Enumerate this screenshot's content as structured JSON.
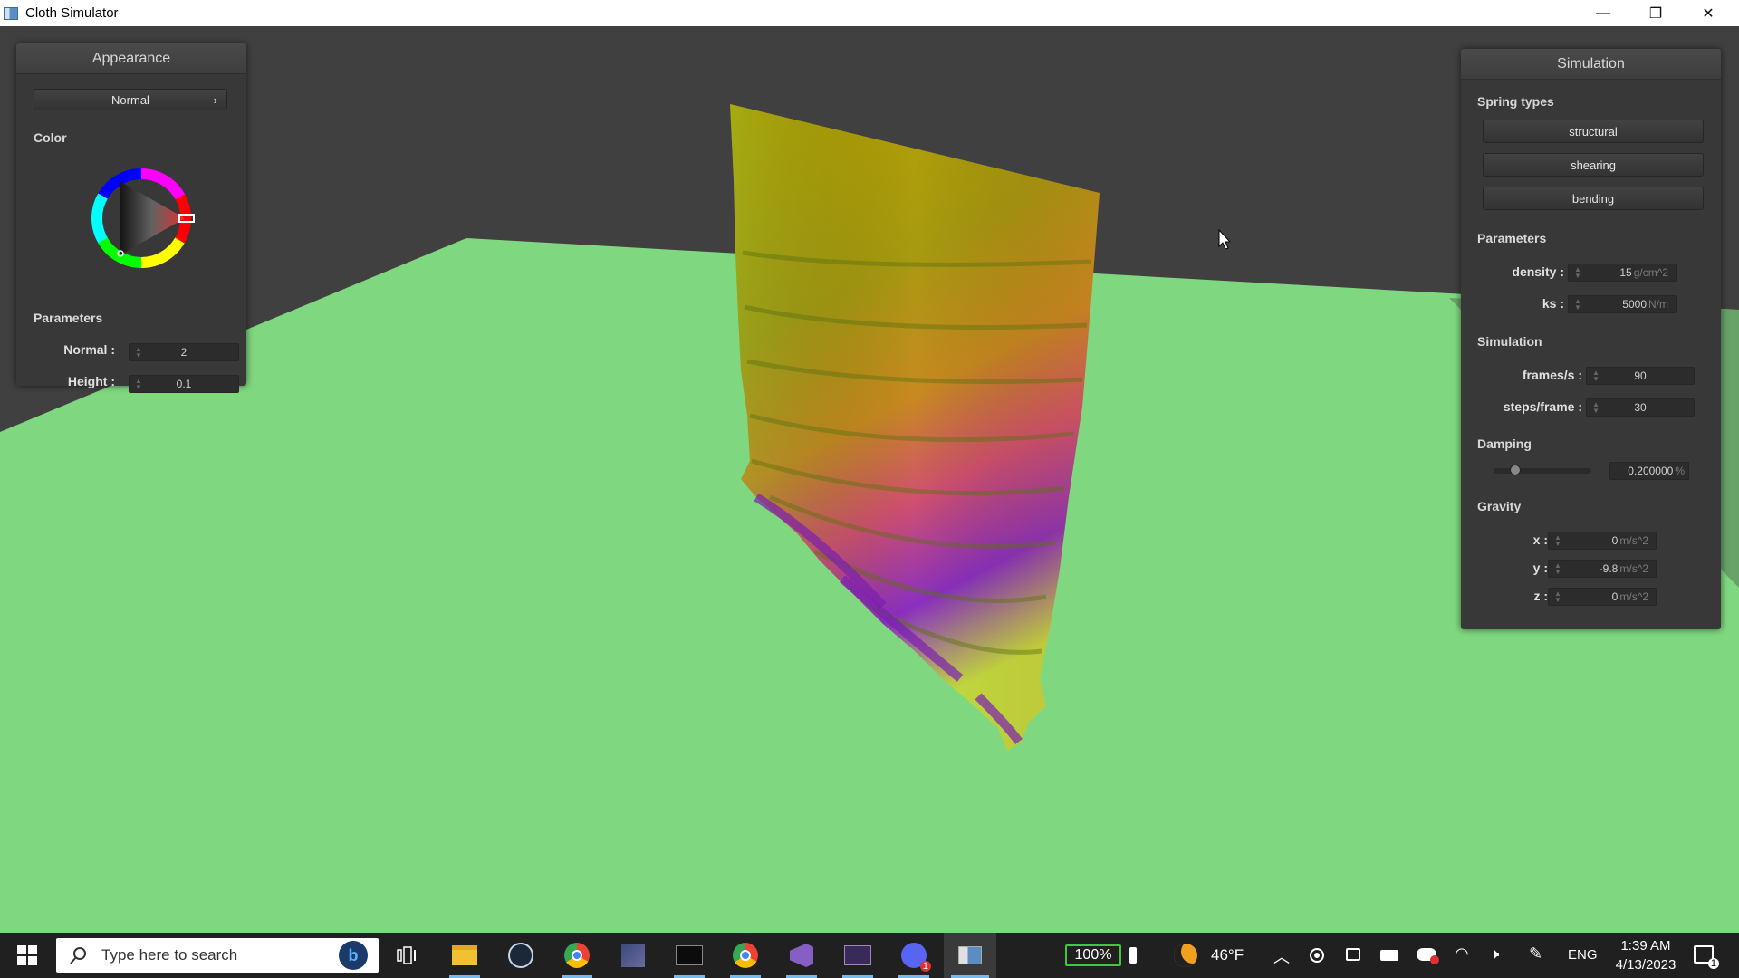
{
  "window": {
    "title": "Cloth Simulator",
    "controls": {
      "minimize": "—",
      "maximize": "❐",
      "close": "✕"
    }
  },
  "appearance_panel": {
    "title": "Appearance",
    "mode_dropdown": {
      "value": "Normal",
      "arrow": "›"
    },
    "color_label": "Color",
    "color_picker": {
      "hue_color": "#e02020"
    },
    "parameters_label": "Parameters",
    "normal": {
      "label": "Normal :",
      "value": "2"
    },
    "height": {
      "label": "Height :",
      "value": "0.1"
    }
  },
  "simulation_panel": {
    "title": "Simulation",
    "spring_types_label": "Spring types",
    "spring_buttons": [
      "structural",
      "shearing",
      "bending"
    ],
    "parameters_label": "Parameters",
    "density": {
      "label": "density :",
      "value": "15",
      "unit": "g/cm^2"
    },
    "ks": {
      "label": "ks :",
      "value": "5000",
      "unit": "N/m"
    },
    "simulation_label": "Simulation",
    "fps": {
      "label": "frames/s :",
      "value": "90"
    },
    "steps": {
      "label": "steps/frame :",
      "value": "30"
    },
    "damping_label": "Damping",
    "damping": {
      "value": "0.200000",
      "unit": "%",
      "slider_fraction": 0.2
    },
    "gravity_label": "Gravity",
    "gravity_x": {
      "label": "x :",
      "value": "0",
      "unit": "m/s^2"
    },
    "gravity_y": {
      "label": "y :",
      "value": "-9.8",
      "unit": "m/s^2"
    },
    "gravity_z": {
      "label": "z :",
      "value": "0",
      "unit": "m/s^2"
    }
  },
  "scene": {
    "background_color": "#404040",
    "ground_color": "#7fd87f"
  },
  "taskbar": {
    "search_placeholder": "Type here to search",
    "battery": "100%",
    "weather": "46°F",
    "language": "ENG",
    "time": "1:39 AM",
    "date": "4/13/2023",
    "notification_count": "1"
  }
}
